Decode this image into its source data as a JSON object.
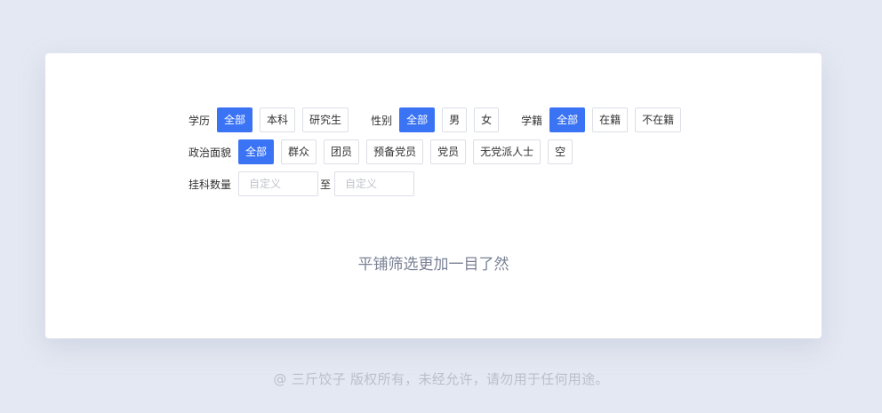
{
  "filters": {
    "education": {
      "label": "学历",
      "options": [
        {
          "label": "全部",
          "active": true
        },
        {
          "label": "本科",
          "active": false
        },
        {
          "label": "研究生",
          "active": false
        }
      ]
    },
    "gender": {
      "label": "性别",
      "options": [
        {
          "label": "全部",
          "active": true
        },
        {
          "label": "男",
          "active": false
        },
        {
          "label": "女",
          "active": false
        }
      ]
    },
    "enrollment": {
      "label": "学籍",
      "options": [
        {
          "label": "全部",
          "active": true
        },
        {
          "label": "在籍",
          "active": false
        },
        {
          "label": "不在籍",
          "active": false
        }
      ]
    },
    "political": {
      "label": "政治面貌",
      "options": [
        {
          "label": "全部",
          "active": true
        },
        {
          "label": "群众",
          "active": false
        },
        {
          "label": "团员",
          "active": false
        },
        {
          "label": "预备党员",
          "active": false
        },
        {
          "label": "党员",
          "active": false
        },
        {
          "label": "无党派人士",
          "active": false
        },
        {
          "label": "空",
          "active": false
        }
      ]
    },
    "failed_count": {
      "label": "挂科数量",
      "min": {
        "value": "",
        "placeholder": "自定义"
      },
      "separator": "至",
      "max": {
        "value": "",
        "placeholder": "自定义"
      }
    }
  },
  "caption": "平铺筛选更加一目了然",
  "footer": "@ 三斤饺子  版权所有，未经允许，请勿用于任何用途。",
  "colors": {
    "accent": "#3b73f5",
    "page_bg": "#e4e8f2",
    "card_bg": "#ffffff",
    "border": "#dcdfe6",
    "caption": "#7a8195",
    "footer": "#b9bfcc"
  }
}
